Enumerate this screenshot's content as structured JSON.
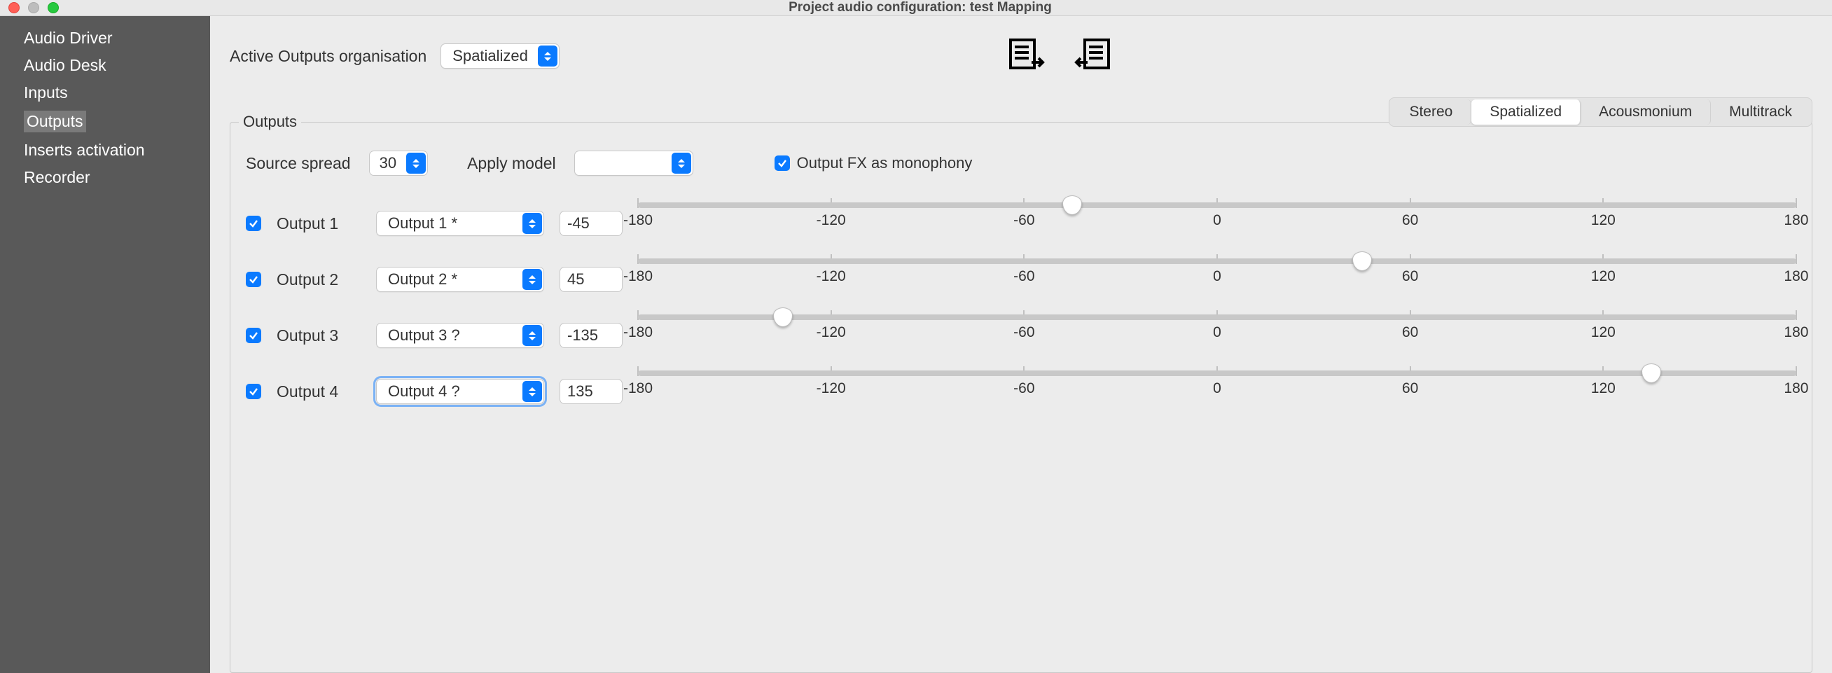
{
  "window": {
    "title": "Project audio configuration: test Mapping"
  },
  "sidebar": {
    "items": [
      {
        "label": "Audio Driver"
      },
      {
        "label": "Audio Desk"
      },
      {
        "label": "Inputs"
      },
      {
        "label": "Outputs",
        "selected": true
      },
      {
        "label": "Inserts activation"
      },
      {
        "label": "Recorder"
      }
    ]
  },
  "toprow": {
    "active_outputs_label": "Active Outputs organisation",
    "active_outputs_value": "Spatialized"
  },
  "tabs": {
    "items": [
      {
        "label": "Stereo"
      },
      {
        "label": "Spatialized",
        "active": true
      },
      {
        "label": "Acousmonium"
      },
      {
        "label": "Multitrack"
      }
    ]
  },
  "fieldset": {
    "legend": "Outputs",
    "source_spread_label": "Source spread",
    "source_spread_value": "30",
    "apply_model_label": "Apply model",
    "apply_model_value": "",
    "monophony_label": "Output FX as monophony",
    "monophony_checked": true
  },
  "slider": {
    "min": -180,
    "max": 180,
    "ticks": [
      "-180",
      "-120",
      "-60",
      "0",
      "60",
      "120",
      "180"
    ]
  },
  "outputs": [
    {
      "enabled": true,
      "name": "Output 1",
      "select": "Output 1 *",
      "value": "-45"
    },
    {
      "enabled": true,
      "name": "Output 2",
      "select": "Output 2 *",
      "value": "45"
    },
    {
      "enabled": true,
      "name": "Output 3",
      "select": "Output 3 ?",
      "value": "-135"
    },
    {
      "enabled": true,
      "name": "Output 4",
      "select": "Output 4 ?",
      "value": "135",
      "focused": true
    }
  ]
}
